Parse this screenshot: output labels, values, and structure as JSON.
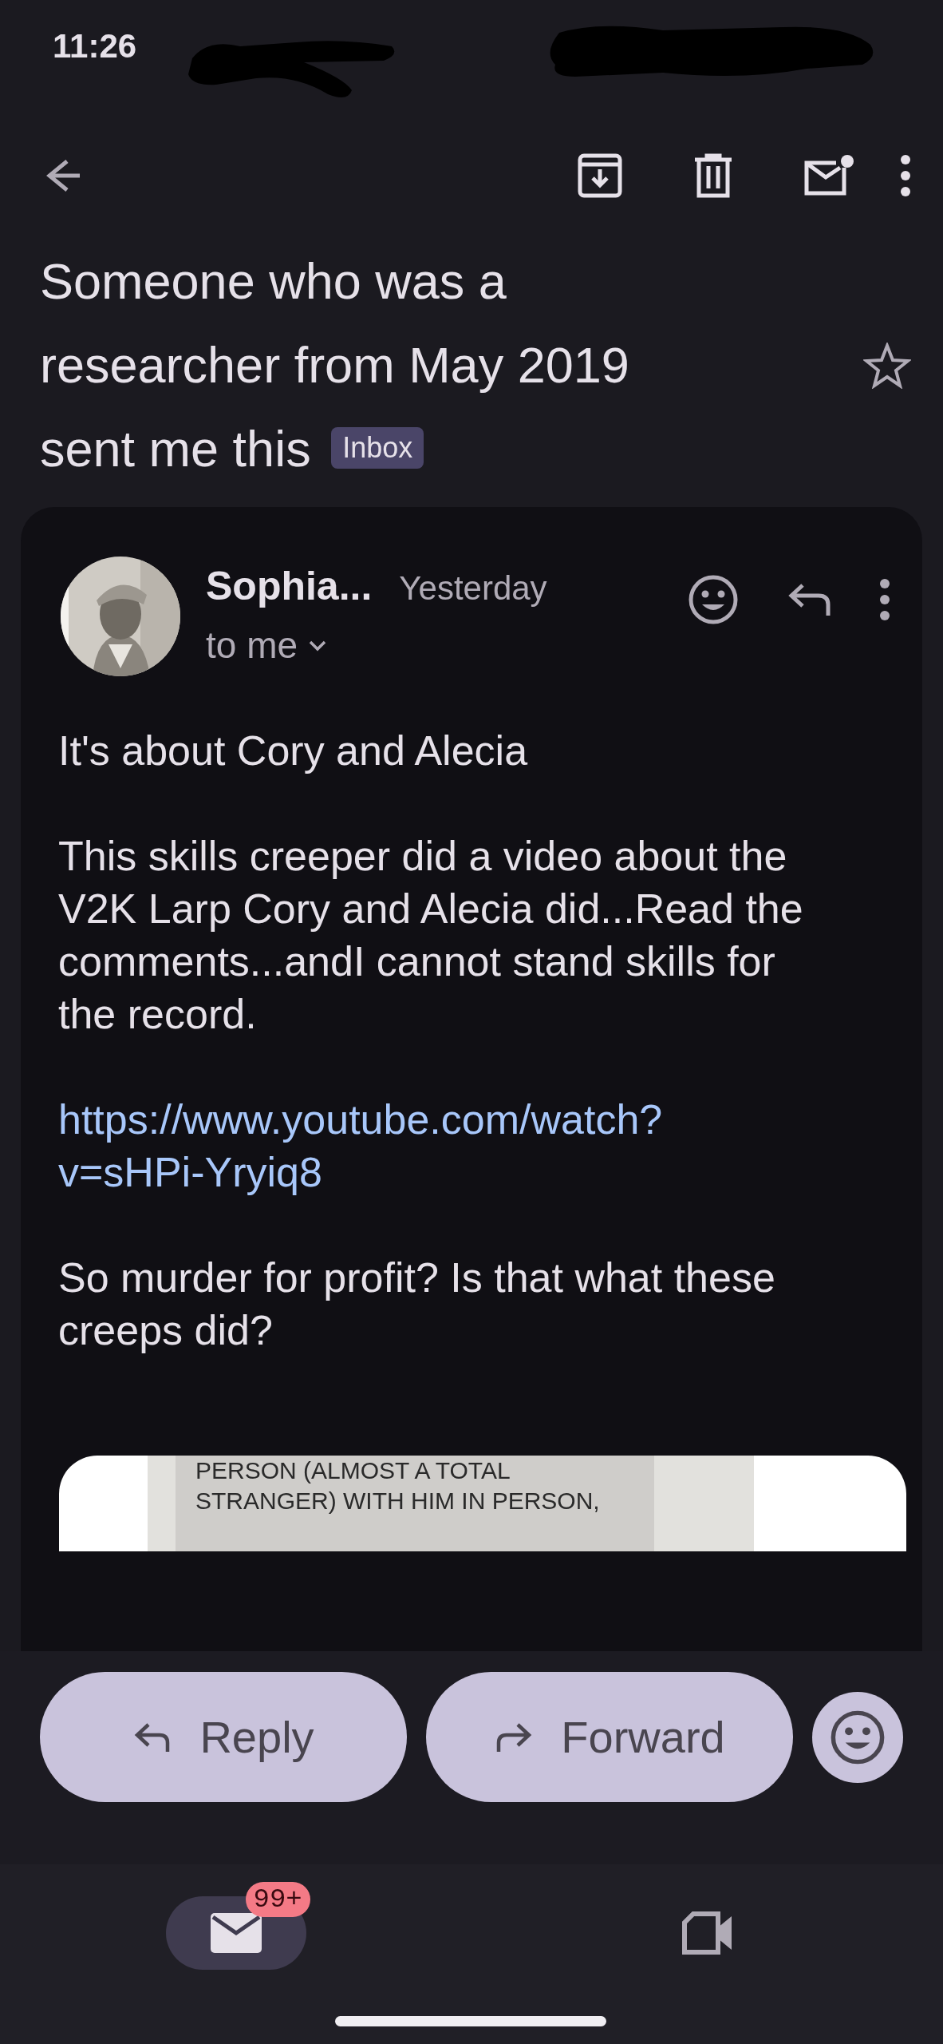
{
  "status_bar": {
    "time": "11:26"
  },
  "subject": {
    "text": "Someone who was a researcher from May 2019 sent me this",
    "label": "Inbox",
    "starred": false
  },
  "message": {
    "sender": "Sophia...",
    "time": "Yesterday",
    "recipient": "to me",
    "body": [
      {
        "kind": "text",
        "text": "It's about Cory and Alecia"
      },
      {
        "kind": "text",
        "text": "This skills creeper did a video about the V2K Larp Cory and Alecia did...Read the comments...andI cannot stand skills for the record."
      },
      {
        "kind": "link",
        "text": "https://www.youtube.com/watch?v=sHPi-Yryiq8"
      },
      {
        "kind": "text",
        "text": "So murder for profit? Is that what these creeps did?"
      }
    ],
    "attachment": {
      "lines": [
        "PERSON (ALMOST A TOTAL",
        "STRANGER) WITH HIM IN PERSON,"
      ]
    }
  },
  "actions": [
    {
      "kind": "reply",
      "label": "Reply"
    },
    {
      "kind": "forward",
      "label": "Forward"
    }
  ],
  "nav": [
    {
      "kind": "mail",
      "selected": true,
      "badge": "99+"
    },
    {
      "kind": "video",
      "selected": false
    }
  ]
}
